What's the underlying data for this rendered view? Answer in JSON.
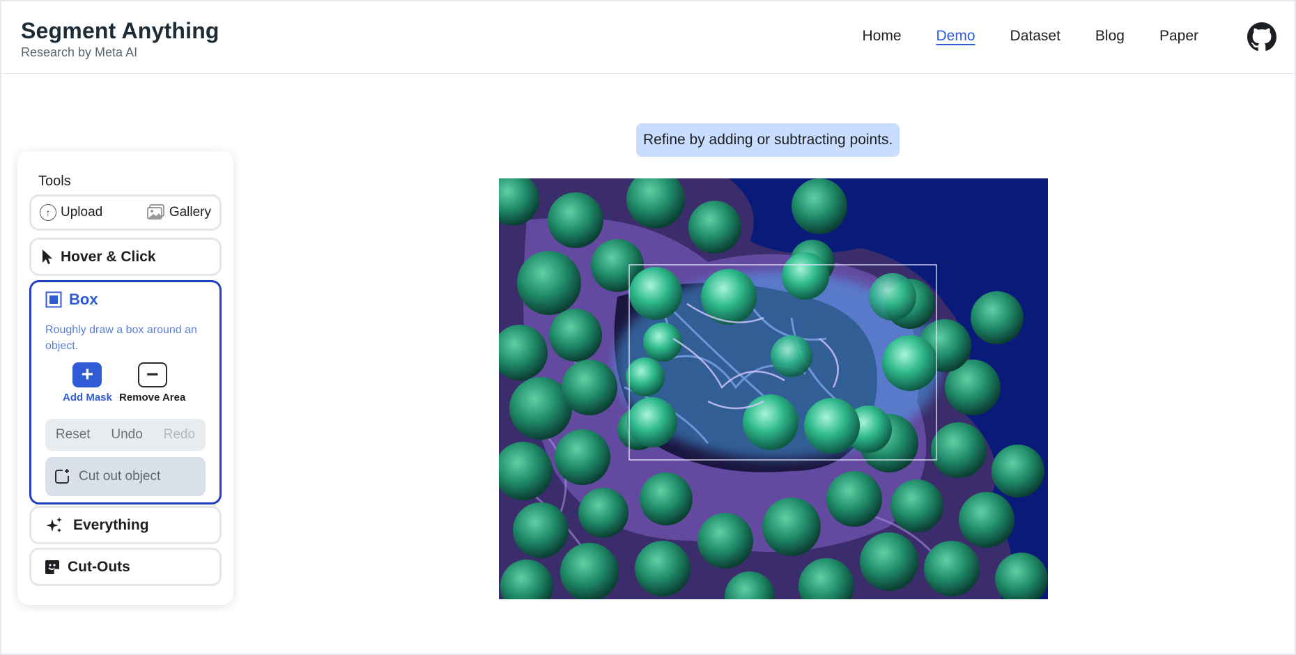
{
  "header": {
    "title": "Segment Anything",
    "subtitle": "Research by Meta AI",
    "nav": [
      "Home",
      "Demo",
      "Dataset",
      "Blog",
      "Paper"
    ],
    "active_nav": "Demo",
    "github_icon": "github-icon"
  },
  "tools": {
    "title": "Tools",
    "upload_label": "Upload",
    "gallery_label": "Gallery",
    "hover_label": "Hover & Click",
    "box": {
      "label": "Box",
      "description": "Roughly draw a box around an object.",
      "add_mask": "Add Mask",
      "remove_area": "Remove Area",
      "reset": "Reset",
      "undo": "Undo",
      "redo": "Redo",
      "cut_out": "Cut out object"
    },
    "everything_label": "Everything",
    "cutouts_label": "Cut-Outs"
  },
  "instruction": "Refine by adding or subtracting points.",
  "colors": {
    "accent": "#2f5cd6",
    "hint_bg": "#c9ddff",
    "canvas_bg": "#0a1a78",
    "cell_green": "#1f8a68",
    "fiber_purple": "#8a63c8"
  }
}
